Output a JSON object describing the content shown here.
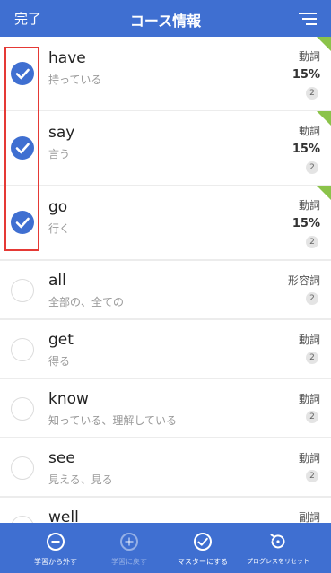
{
  "header": {
    "done_label": "完了",
    "title": "コース情報",
    "sort_icon": "sort-icon"
  },
  "rows": [
    {
      "word": "have",
      "meaning": "持っている",
      "pos": "動詞",
      "percent": "15%",
      "count": "2",
      "checked": true,
      "has_corner": true
    },
    {
      "word": "say",
      "meaning": "言う",
      "pos": "動詞",
      "percent": "15%",
      "count": "2",
      "checked": true,
      "has_corner": true
    },
    {
      "word": "go",
      "meaning": "行く",
      "pos": "動詞",
      "percent": "15%",
      "count": "2",
      "checked": true,
      "has_corner": true
    },
    {
      "word": "all",
      "meaning": "全部の、全ての",
      "pos": "形容詞",
      "count": "2",
      "checked": false
    },
    {
      "word": "get",
      "meaning": "得る",
      "pos": "動詞",
      "count": "2",
      "checked": false
    },
    {
      "word": "know",
      "meaning": "知っている、理解している",
      "pos": "動詞",
      "count": "2",
      "checked": false
    },
    {
      "word": "see",
      "meaning": "見える、見る",
      "pos": "動詞",
      "count": "2",
      "checked": false
    },
    {
      "word": "well",
      "meaning": "",
      "pos": "副詞",
      "count": "",
      "checked": false
    }
  ],
  "bottom_actions": [
    {
      "label": "学習から外す",
      "icon": "minus-circle-icon",
      "enabled": true
    },
    {
      "label": "学習に戻す",
      "icon": "plus-circle-icon",
      "enabled": false
    },
    {
      "label": "マスターにする",
      "icon": "check-circle-icon",
      "enabled": true
    },
    {
      "label": "プログレスをリセット",
      "icon": "reset-icon",
      "enabled": true
    }
  ],
  "colors": {
    "brand": "#3f6fd1",
    "highlight": "#e53935",
    "progress_corner": "#8bc34a"
  }
}
